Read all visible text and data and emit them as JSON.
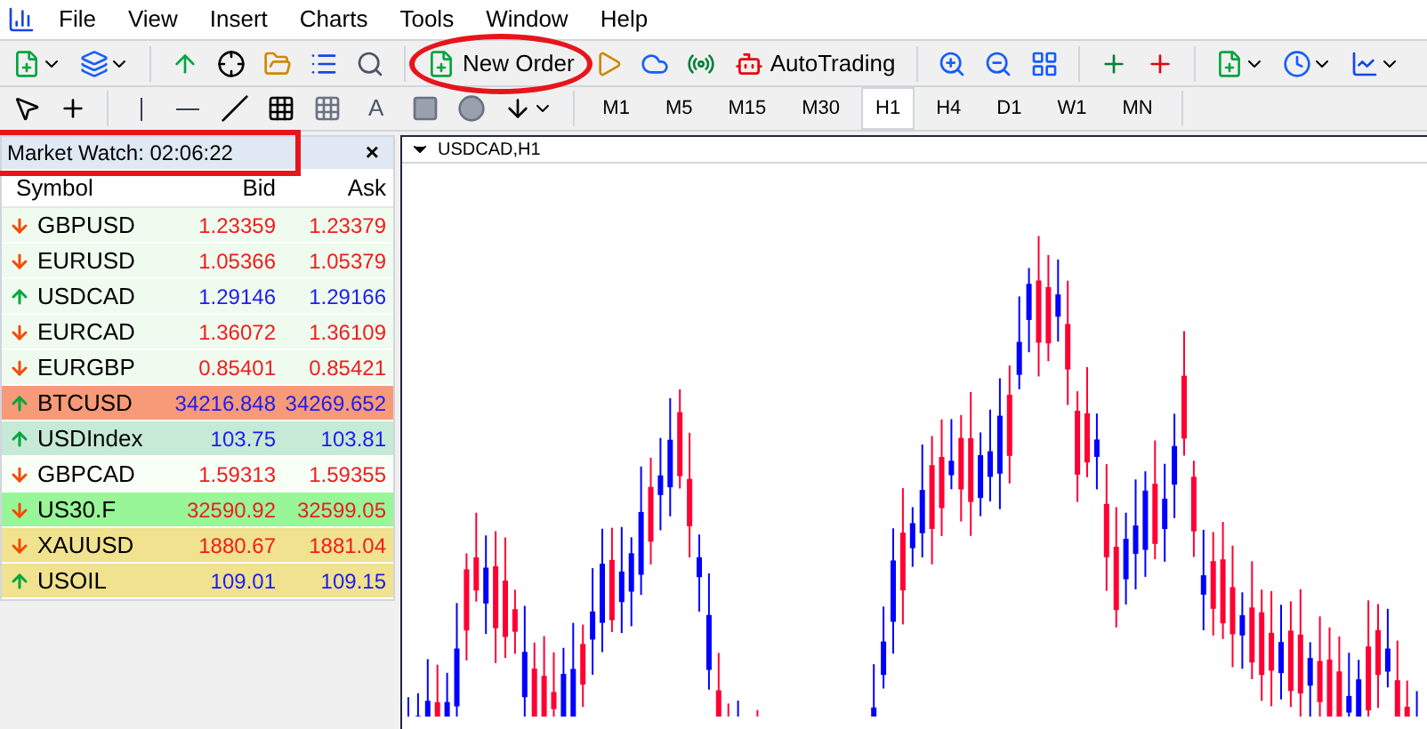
{
  "menu": [
    "File",
    "View",
    "Insert",
    "Charts",
    "Tools",
    "Window",
    "Help"
  ],
  "toolbar": {
    "new_order": "New Order",
    "auto_trading": "AutoTrading"
  },
  "drawing_tools": {
    "text_tool": "A"
  },
  "timeframes": [
    {
      "label": "M1",
      "selected": false
    },
    {
      "label": "M5",
      "selected": false
    },
    {
      "label": "M15",
      "selected": false
    },
    {
      "label": "M30",
      "selected": false
    },
    {
      "label": "H1",
      "selected": true
    },
    {
      "label": "H4",
      "selected": false
    },
    {
      "label": "D1",
      "selected": false
    },
    {
      "label": "W1",
      "selected": false
    },
    {
      "label": "MN",
      "selected": false
    }
  ],
  "market_watch": {
    "title": "Market Watch: 02:06:22",
    "close": "×",
    "columns": [
      "Symbol",
      "Bid",
      "Ask"
    ],
    "rows": [
      {
        "symbol": "GBPUSD",
        "bid": "1.23359",
        "ask": "1.23379",
        "kind": "down",
        "color": "#eefbee"
      },
      {
        "symbol": "EURUSD",
        "bid": "1.05366",
        "ask": "1.05379",
        "kind": "down",
        "color": "#eefbee"
      },
      {
        "symbol": "USDCAD",
        "bid": "1.29146",
        "ask": "1.29166",
        "kind": "up",
        "color": "#eefbee"
      },
      {
        "symbol": "EURCAD",
        "bid": "1.36072",
        "ask": "1.36109",
        "kind": "down",
        "color": "#eefbee"
      },
      {
        "symbol": "EURGBP",
        "bid": "0.85401",
        "ask": "0.85421",
        "kind": "down",
        "color": "#eefbee"
      },
      {
        "symbol": "BTCUSD",
        "bid": "34216.848",
        "ask": "34269.652",
        "kind": "up",
        "color": "#f79a78"
      },
      {
        "symbol": "USDIndex",
        "bid": "103.75",
        "ask": "103.81",
        "kind": "up",
        "color": "#c6ead6"
      },
      {
        "symbol": "GBPCAD",
        "bid": "1.59313",
        "ask": "1.59355",
        "kind": "down",
        "color": "#f7fff7"
      },
      {
        "symbol": "US30.F",
        "bid": "32590.92",
        "ask": "32599.05",
        "kind": "down",
        "color": "#98f598"
      },
      {
        "symbol": "XAUUSD",
        "bid": "1880.67",
        "ask": "1881.04",
        "kind": "down",
        "color": "#f0e28e"
      },
      {
        "symbol": "USOIL",
        "bid": "109.01",
        "ask": "109.15",
        "kind": "up",
        "color": "#f0e28e"
      }
    ]
  },
  "chart": {
    "title": "USDCAD,H1"
  }
}
